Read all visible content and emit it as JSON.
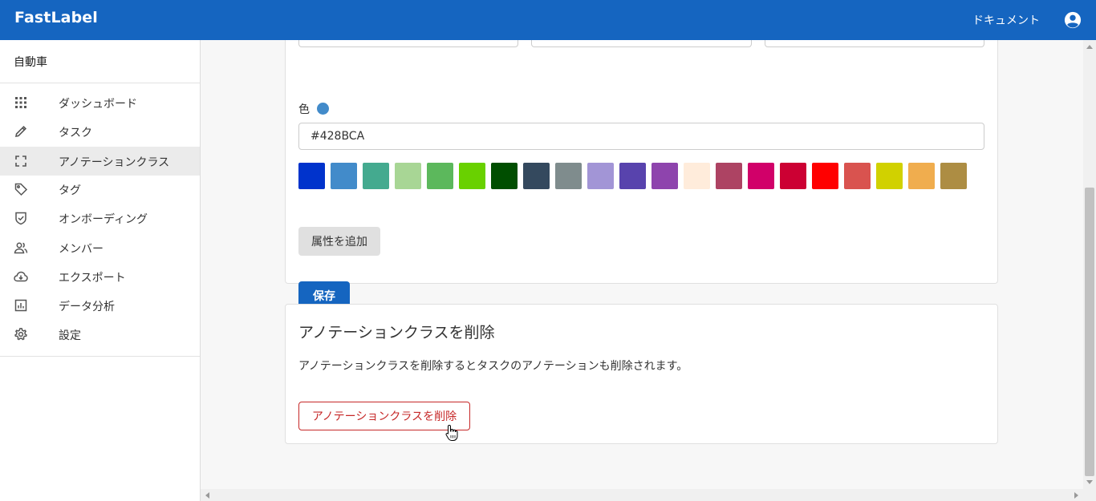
{
  "header": {
    "brand": "FastLabel",
    "docs_label": "ドキュメント",
    "account_icon": "account-circle-icon",
    "color": "#1565c0"
  },
  "sidebar": {
    "project_name": "自動車",
    "items": [
      {
        "label": "ダッシュボード",
        "icon": "grid-icon",
        "active": false
      },
      {
        "label": "タスク",
        "icon": "pencil-icon",
        "active": false
      },
      {
        "label": "アノテーションクラス",
        "icon": "fullscreen-frame-icon",
        "active": true
      },
      {
        "label": "タグ",
        "icon": "tag-icon",
        "active": false
      },
      {
        "label": "オンボーディング",
        "icon": "shield-check-icon",
        "active": false
      },
      {
        "label": "メンバー",
        "icon": "people-icon",
        "active": false
      },
      {
        "label": "エクスポート",
        "icon": "cloud-download-icon",
        "active": false
      },
      {
        "label": "データ分析",
        "icon": "bar-chart-icon",
        "active": false
      },
      {
        "label": "設定",
        "icon": "gear-icon",
        "active": false
      }
    ]
  },
  "edit_form": {
    "color_label": "色",
    "color_value": "#428BCA",
    "swatches": [
      "#0033cc",
      "#428bca",
      "#44aa8f",
      "#a8d695",
      "#5cb85c",
      "#69d100",
      "#004e00",
      "#34495e",
      "#7f8c8d",
      "#a295d6",
      "#5843ad",
      "#8e44ad",
      "#ffecdb",
      "#ad4363",
      "#d10069",
      "#cc0033",
      "#ff0000",
      "#d9534f",
      "#d1d100",
      "#f0ad4e",
      "#ad8d43"
    ],
    "add_attribute_label": "属性を追加",
    "save_label": "保存"
  },
  "delete_section": {
    "title": "アノテーションクラスを削除",
    "description": "アノテーションクラスを削除するとタスクのアノテーションも削除されます。",
    "button_label": "アノテーションクラスを削除",
    "button_color": "#c62828"
  }
}
